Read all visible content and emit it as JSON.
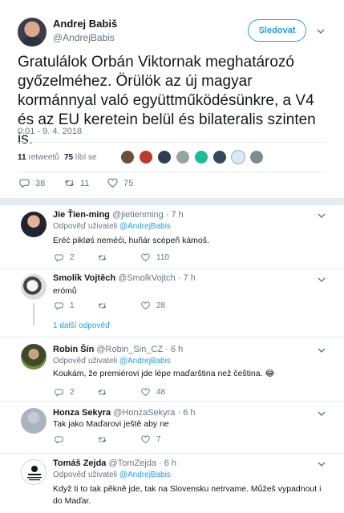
{
  "tweet": {
    "author_name": "Andrej Babiš",
    "author_handle": "@AndrejBabis",
    "follow_label": "Sledovat",
    "text": "Gratulálok Orbán Viktornak meghatározó győzelméhez. Örülök az új magyar kormánnyal való együttműködésünkre, a V4 és az EU keretein belül és bilateralis szinten is.",
    "time": "0:01 - 9. 4. 2018",
    "retweets_count": "11",
    "retweets_label": "retweetů",
    "likes_count": "75",
    "likes_label": "líbí se",
    "liker_avatar_count": 8,
    "actions": {
      "replies": "38",
      "retweets": "11",
      "likes": "75"
    }
  },
  "replies": [
    {
      "name": "Jie Ťien-ming",
      "handle": "@jietienming",
      "time": "· 7 h",
      "reply_to_prefix": "Odpověď uživateli",
      "reply_to": "@AndrejBabis",
      "text": "Eréć pikløś neméći, huñár scépeñ kámoš.",
      "actions": {
        "replies": "2",
        "retweets": "",
        "likes": "110"
      }
    },
    {
      "name": "Smolík Vojtěch",
      "handle": "@SmolkVojtch",
      "time": "· 7 h",
      "text": "erómů",
      "actions": {
        "replies": "1",
        "retweets": "",
        "likes": "28"
      },
      "more_replies": "1 další odpověď"
    },
    {
      "name": "Robin Šín",
      "handle": "@Robin_Sin_CZ",
      "time": "· 6 h",
      "reply_to_prefix": "Odpověď uživateli",
      "reply_to": "@AndrejBabis",
      "text": "Koukám, že premiérovi jde lépe maďarština než čeština. 😂",
      "actions": {
        "replies": "2",
        "retweets": "",
        "likes": "48"
      }
    },
    {
      "name": "Honza Sekyra",
      "handle": "@HonzaSekyra",
      "time": "· 6 h",
      "text": "Tak jako Maďarovi ještě aby ne",
      "actions": {
        "replies": "",
        "retweets": "",
        "likes": "7"
      }
    },
    {
      "name": "Tomáš Zejda",
      "handle": "@TomZejda",
      "time": "· 6 h",
      "reply_to_prefix": "Odpověď uživateli",
      "reply_to": "@AndrejBabis",
      "text": "Když ti to tak pěkně jde, tak na Slovensku netrvame. Můžeš vypadnout i do Maďar."
    }
  ],
  "colors": {
    "accent": "#1da1f2",
    "muted": "#657786",
    "separator": "#e6ecf0"
  }
}
